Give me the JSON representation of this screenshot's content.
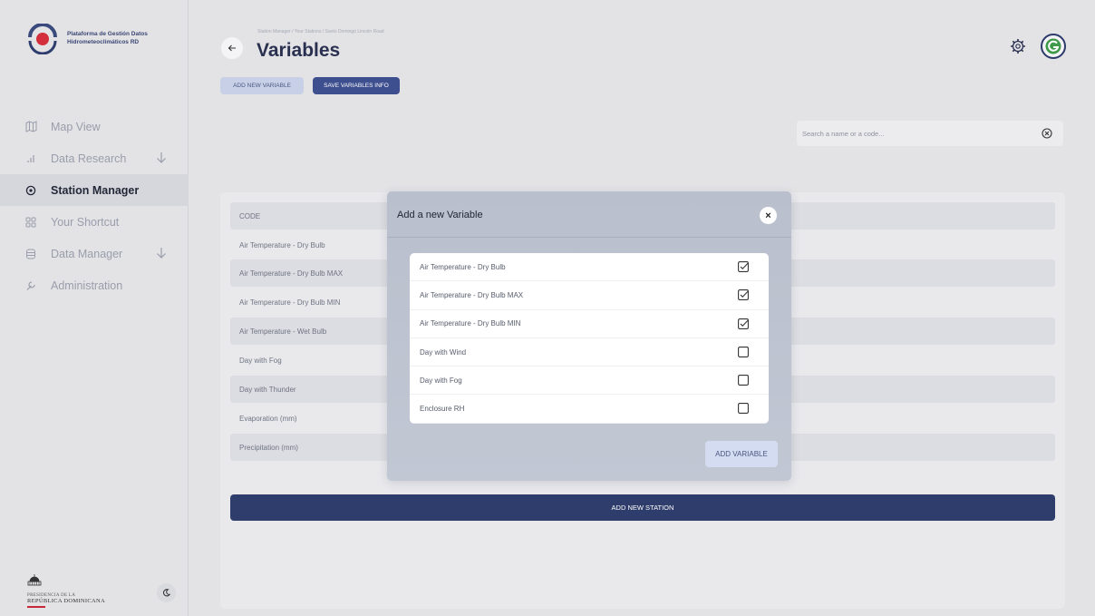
{
  "app": {
    "logo_line1": "Plataforma de Gestión Datos",
    "logo_line2": "Hidrometeoclimáticos RD"
  },
  "sidebar": {
    "items": [
      {
        "label": "Map View",
        "icon": "map-icon"
      },
      {
        "label": "Data Research",
        "icon": "bar-chart-icon"
      },
      {
        "label": "Station Manager",
        "icon": "location-pin-icon",
        "active": true
      },
      {
        "label": "Your Shortcut",
        "icon": "grid-icon"
      },
      {
        "label": "Data Manager",
        "icon": "database-icon"
      },
      {
        "label": "Administration",
        "icon": "wrench-icon"
      }
    ],
    "footer_line1": "PRESIDENCIA DE LA",
    "footer_line2": "REPÚBLICA DOMINICANA"
  },
  "header": {
    "breadcrumb": "Station Manager / Your Stations / Santo Domingo Lincoln Road",
    "title": "Variables",
    "add_variable_label": "ADD NEW VARIABLE",
    "save_variables_label": "SAVE VARIABLES INFO"
  },
  "search": {
    "placeholder": "Search a name or a code..."
  },
  "table": {
    "header": "CODE",
    "rows": [
      "Air Temperature - Dry Bulb",
      "Air Temperature - Dry Bulb MAX",
      "Air Temperature - Dry Bulb MIN",
      "Air Temperature - Wet Bulb",
      "Day with Fog",
      "Day with Thunder",
      "Evaporation (mm)",
      "Precipitation (mm)"
    ],
    "add_station_label": "ADD NEW STATION"
  },
  "modal": {
    "title": "Add a new Variable",
    "close_glyph": "×",
    "options": [
      {
        "label": "Air Temperature - Dry Bulb",
        "checked": true
      },
      {
        "label": "Air Temperature - Dry Bulb MAX",
        "checked": true
      },
      {
        "label": "Air Temperature - Dry Bulb MIN",
        "checked": true
      },
      {
        "label": "Day with Wind",
        "checked": false
      },
      {
        "label": "Day with Fog",
        "checked": false
      },
      {
        "label": "Enclosure RH",
        "checked": false
      }
    ],
    "submit_label": "ADD VARIABLE"
  },
  "colors": {
    "primary": "#2e3d6b",
    "accent_red": "#c8263a",
    "background": "#e3e3e6"
  }
}
